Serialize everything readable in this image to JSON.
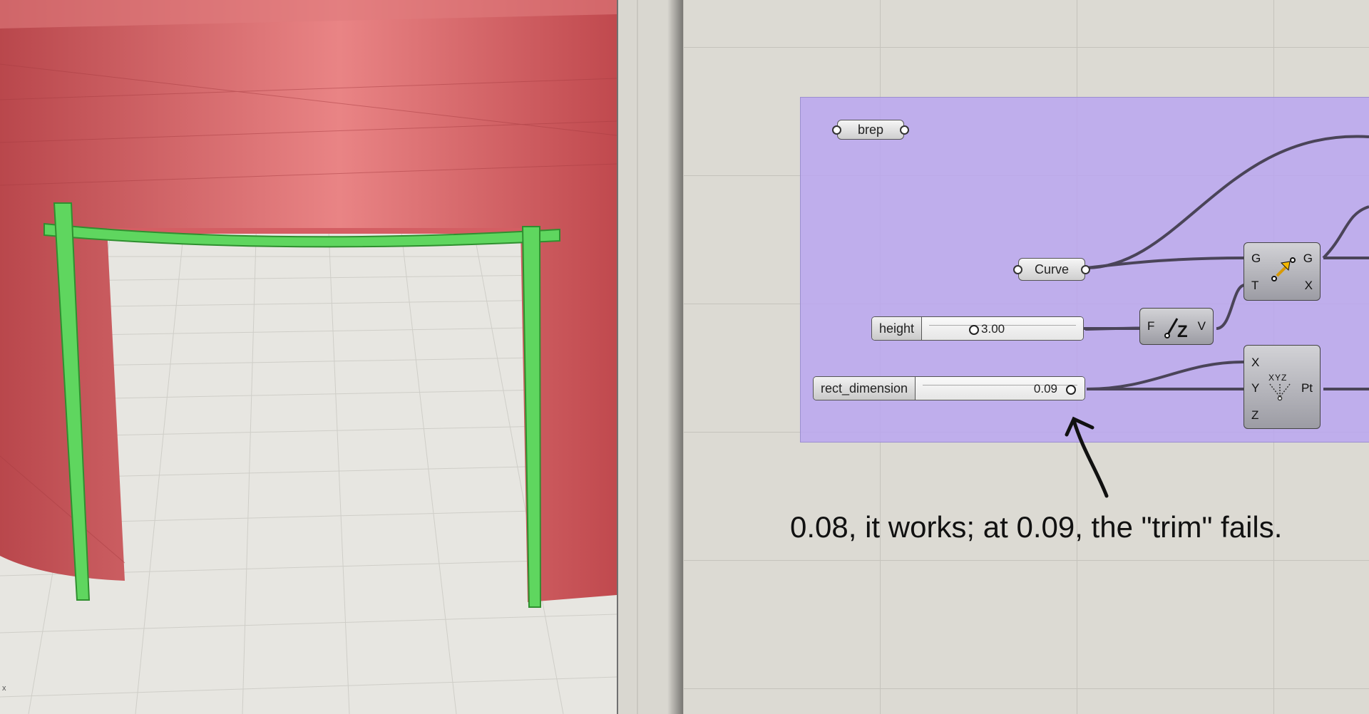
{
  "viewport": {
    "axis_label": "x"
  },
  "canvas": {
    "brep_param": "brep",
    "curve_param": "Curve",
    "height_slider": {
      "label": "height",
      "value": "3.00"
    },
    "rect_slider": {
      "label": "rect_dimension",
      "value": "0.09"
    },
    "move_component": {
      "inputs": [
        "G",
        "T"
      ],
      "outputs": [
        "G",
        "X"
      ]
    },
    "unitz_component": {
      "input": "F",
      "output": "V"
    },
    "construct_point": {
      "inputs": [
        "X",
        "Y",
        "Z"
      ],
      "output": "Pt",
      "icon_text": "XYZ"
    },
    "annotation": "0.08, it works; at 0.09, the \"trim\" fails."
  },
  "colors": {
    "surface_red": "#c8555a",
    "beam_green": "#5fd65f",
    "group_purple": "#baa6f0"
  }
}
